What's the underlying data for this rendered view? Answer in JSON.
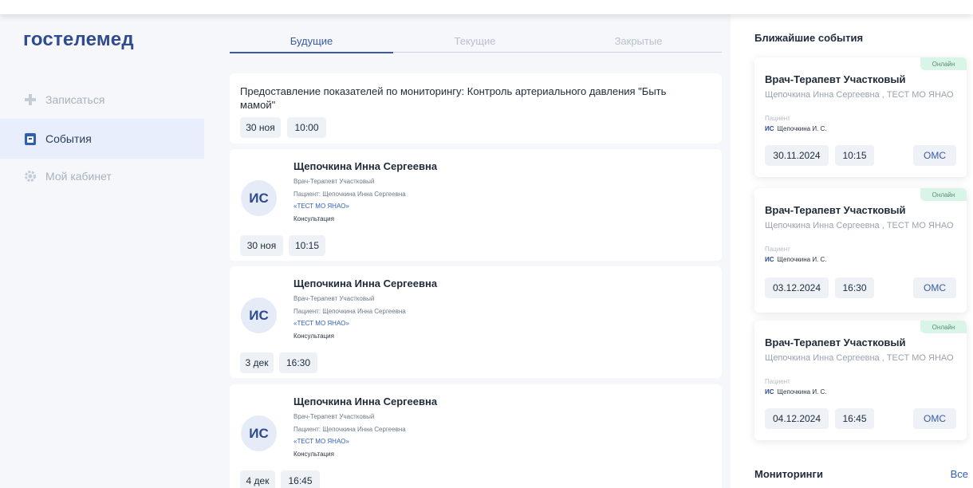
{
  "logo": "гостелемед",
  "nav": [
    {
      "label": "Записаться",
      "icon": "plus-icon"
    },
    {
      "label": "События",
      "icon": "calendar-icon"
    },
    {
      "label": "Мой кабинет",
      "icon": "gear-icon"
    }
  ],
  "tabs": {
    "future": "Будущие",
    "current": "Текущие",
    "closed": "Закрытые"
  },
  "monitoring_card": {
    "title": "Предоставление показателей по мониторингу: Контроль артериального давления \"Быть мамой\"",
    "date": "30 ноя",
    "time": "10:00"
  },
  "appointments": [
    {
      "initials": "ИС",
      "name": "Щепочкина Инна Сергеевна",
      "specialty": "Врач-Терапевт Участковый",
      "patient": "Пациент: Щепочкина Инна Сергеевна",
      "org": "«ТЕСТ МО ЯНАО»",
      "type": "Консультация",
      "date": "30 ноя",
      "time": "10:15"
    },
    {
      "initials": "ИС",
      "name": "Щепочкина Инна Сергеевна",
      "specialty": "Врач-Терапевт Участковый",
      "patient": "Пациент: Щепочкина Инна Сергеевна",
      "org": "«ТЕСТ МО ЯНАО»",
      "type": "Консультация",
      "date": "3 дек",
      "time": "16:30"
    },
    {
      "initials": "ИС",
      "name": "Щепочкина Инна Сергеевна",
      "specialty": "Врач-Терапевт Участковый",
      "patient": "Пациент: Щепочкина Инна Сергеевна",
      "org": "«ТЕСТ МО ЯНАО»",
      "type": "Консультация",
      "date": "4 дек",
      "time": "16:45"
    }
  ],
  "right": {
    "title": "Ближайшие события",
    "events": [
      {
        "badge": "Онлайн",
        "specialty": "Врач-Терапевт Участковый",
        "doctor": "Щепочкина Инна Сергеевна , ТЕСТ МО ЯНАО",
        "patient_label": "Пациент",
        "patient_initials": "ИС",
        "patient_name": "Щепочкина И. С.",
        "date": "30.11.2024",
        "time": "10:15",
        "payment": "ОМС"
      },
      {
        "badge": "Онлайн",
        "specialty": "Врач-Терапевт Участковый",
        "doctor": "Щепочкина Инна Сергеевна , ТЕСТ МО ЯНАО",
        "patient_label": "Пациент",
        "patient_initials": "ИС",
        "patient_name": "Щепочкина И. С.",
        "date": "03.12.2024",
        "time": "16:30",
        "payment": "ОМС"
      },
      {
        "badge": "Онлайн",
        "specialty": "Врач-Терапевт Участковый",
        "doctor": "Щепочкина Инна Сергеевна , ТЕСТ МО ЯНАО",
        "patient_label": "Пациент",
        "patient_initials": "ИС",
        "patient_name": "Щепочкина И. С.",
        "date": "04.12.2024",
        "time": "16:45",
        "payment": "ОМС"
      }
    ],
    "monitoring_title": "Мониторинги",
    "monitoring_all": "Все"
  }
}
